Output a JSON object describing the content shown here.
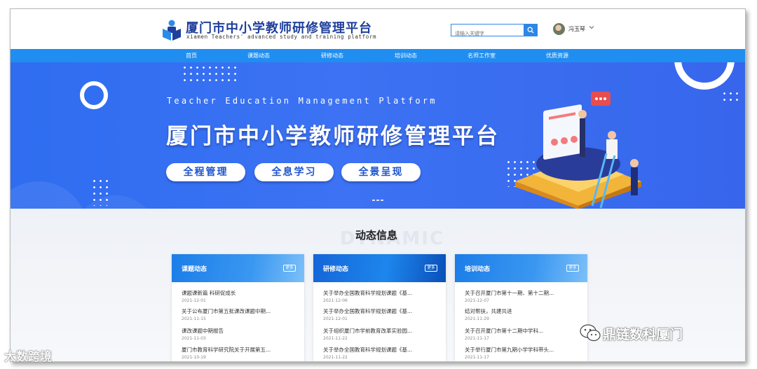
{
  "header": {
    "title": "厦门市中小学教师研修管理平台",
    "subtitle": "xiamen Teachers' advanced study and training platform",
    "search_placeholder": "请输入关键字",
    "user_name": "冯玉琴"
  },
  "nav": {
    "items": [
      "首页",
      "课题动态",
      "研修动态",
      "培训动态",
      "名师工作室",
      "优质资源"
    ]
  },
  "banner": {
    "english_title": "Teacher Education Management Platform",
    "title": "厦门市中小学教师研修管理平台",
    "pills": [
      "全程管理",
      "全息学习",
      "全景呈现"
    ]
  },
  "section": {
    "bg_text": "DYNAMIC",
    "title": "动态信息"
  },
  "cards": [
    {
      "title": "课题动态",
      "more": "更多",
      "items": [
        {
          "title": "课题课新篇 科研促成长",
          "date": "2021-12-01"
        },
        {
          "title": "关于公布厦门市第五批课改课题中期...",
          "date": "2021-11-15"
        },
        {
          "title": "课改课题中期报告",
          "date": "2021-11-03"
        },
        {
          "title": "厦门市教育科学研究院关于开展第五...",
          "date": "2021-10-19"
        }
      ]
    },
    {
      "title": "研修动态",
      "more": "更多",
      "items": [
        {
          "title": "关于举办全国教育科学规划课题《基...",
          "date": "2021-12-06"
        },
        {
          "title": "关于举办全国教育科学规划课题《基...",
          "date": "2021-12-01"
        },
        {
          "title": "关于组织厦门市学前教育改革实验园...",
          "date": "2021-11-22"
        },
        {
          "title": "关于举办全国教育科学规划课题《基...",
          "date": "2021-11-22"
        }
      ]
    },
    {
      "title": "培训动态",
      "more": "更多",
      "items": [
        {
          "title": "关于召开厦门市第十一期、第十二期...",
          "date": "2021-12-07"
        },
        {
          "title": "结对帮扶，共建共进",
          "date": "2021-11-29"
        },
        {
          "title": "关于召开厦门市第十二期中学科...",
          "date": "2021-11-17"
        },
        {
          "title": "关于举行厦门市第九期小学学科带头...",
          "date": "2021-11-17"
        }
      ]
    }
  ],
  "watermarks": {
    "left": "大数跨境",
    "right": "鼎链数科厦门"
  },
  "colors": {
    "brand_blue": "#1f8ef0",
    "title_blue": "#1f3f9c",
    "banner_blue": "#3c72f3"
  }
}
